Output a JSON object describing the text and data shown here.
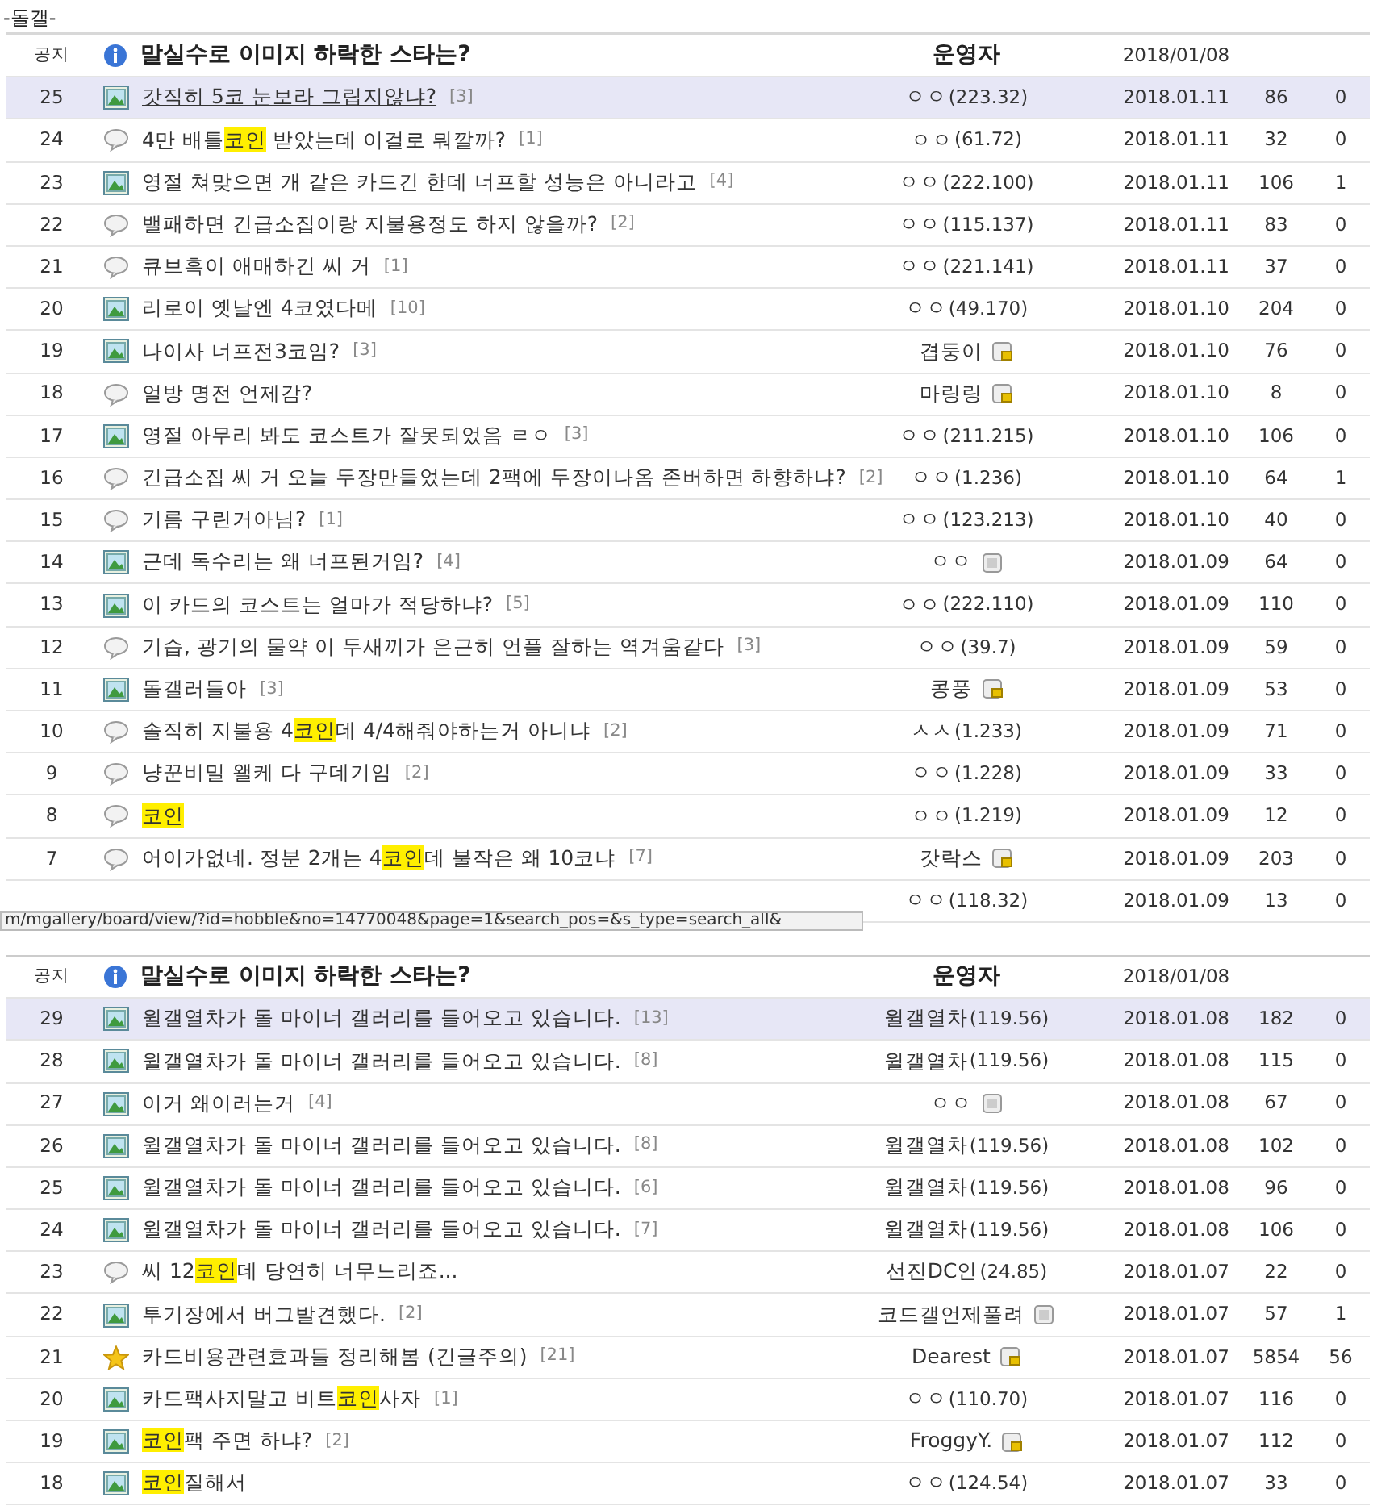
{
  "board_title": "-돌갤-",
  "sections": [
    {
      "notice": {
        "label": "공지",
        "title": "말실수로 이미지 하락한 스타는?",
        "author": "운영자",
        "date": "2018/01/08"
      },
      "posts": [
        {
          "number": "25",
          "kind": "image",
          "title": [
            {
              "text": "갓직히 5코 눈보라 그립지않냐?",
              "highlight": false
            }
          ],
          "comments": "[3]",
          "author": "ㅇㅇ",
          "ip": "(223.32)",
          "date": "2018.01.11",
          "views": "86",
          "recommends": "0",
          "highlighted": true,
          "underlined": true
        },
        {
          "number": "24",
          "kind": "comment",
          "title": [
            {
              "text": "4만 배틀",
              "highlight": false
            },
            {
              "text": "코인",
              "highlight": true
            },
            {
              "text": " 받았는데 이걸로 뭐깔까?",
              "highlight": false
            }
          ],
          "comments": "[1]",
          "author": "ㅇㅇ",
          "ip": "(61.72)",
          "date": "2018.01.11",
          "views": "32",
          "recommends": "0",
          "highlighted": false,
          "underlined": false
        },
        {
          "number": "23",
          "kind": "image",
          "title": [
            {
              "text": "영절 쳐맞으면 개 같은 카드긴 한데 너프할 성능은 아니라고",
              "highlight": false
            }
          ],
          "comments": "[4]",
          "author": "ㅇㅇ",
          "ip": "(222.100)",
          "date": "2018.01.11",
          "views": "106",
          "recommends": "1",
          "highlighted": false,
          "underlined": false
        },
        {
          "number": "22",
          "kind": "comment",
          "title": [
            {
              "text": "밸패하면 긴급소집이랑 지불용정도 하지 않을까?",
              "highlight": false
            }
          ],
          "comments": "[2]",
          "author": "ㅇㅇ",
          "ip": "(115.137)",
          "date": "2018.01.11",
          "views": "83",
          "recommends": "0",
          "highlighted": false,
          "underlined": false
        },
        {
          "number": "21",
          "kind": "comment",
          "title": [
            {
              "text": "큐브흑이 애매하긴 씨 거",
              "highlight": false
            }
          ],
          "comments": "[1]",
          "author": "ㅇㅇ",
          "ip": "(221.141)",
          "date": "2018.01.11",
          "views": "37",
          "recommends": "0",
          "highlighted": false,
          "underlined": false
        },
        {
          "number": "20",
          "kind": "image",
          "title": [
            {
              "text": "리로이 옛날엔 4코였다메",
              "highlight": false
            }
          ],
          "comments": "[10]",
          "author": "ㅇㅇ",
          "ip": "(49.170)",
          "date": "2018.01.10",
          "views": "204",
          "recommends": "0",
          "highlighted": false,
          "underlined": false
        },
        {
          "number": "19",
          "kind": "image",
          "title": [
            {
              "text": "나이사 너프전3코임?",
              "highlight": false
            }
          ],
          "comments": "[3]",
          "author": "겹둥이",
          "author_icon": {
            "kind": "fixed"
          },
          "date": "2018.01.10",
          "views": "76",
          "recommends": "0",
          "highlighted": false,
          "underlined": false
        },
        {
          "number": "18",
          "kind": "comment",
          "title": [
            {
              "text": "얼방 명전 언제감?",
              "highlight": false
            }
          ],
          "author": "마링링",
          "author_icon": {
            "kind": "fixed"
          },
          "date": "2018.01.10",
          "views": "8",
          "recommends": "0",
          "highlighted": false,
          "underlined": false
        },
        {
          "number": "17",
          "kind": "image",
          "title": [
            {
              "text": "영절 아무리 봐도 코스트가 잘못되었음 ㄹㅇ",
              "highlight": false
            }
          ],
          "comments": "[3]",
          "author": "ㅇㅇ",
          "ip": "(211.215)",
          "date": "2018.01.10",
          "views": "106",
          "recommends": "0",
          "highlighted": false,
          "underlined": false
        },
        {
          "number": "16",
          "kind": "comment",
          "title": [
            {
              "text": "긴급소집 씨 거 오늘 두장만들었는데 2팩에 두장이나옴 존버하면 하향하냐?",
              "highlight": false
            }
          ],
          "comments": "[2]",
          "author": "ㅇㅇ",
          "ip": "(1.236)",
          "date": "2018.01.10",
          "views": "64",
          "recommends": "1",
          "highlighted": false,
          "underlined": false
        },
        {
          "number": "15",
          "kind": "comment",
          "title": [
            {
              "text": "기름 구린거아님?",
              "highlight": false
            }
          ],
          "comments": "[1]",
          "author": "ㅇㅇ",
          "ip": "(123.213)",
          "date": "2018.01.10",
          "views": "40",
          "recommends": "0",
          "highlighted": false,
          "underlined": false
        },
        {
          "number": "14",
          "kind": "image",
          "title": [
            {
              "text": "근데 독수리는 왜 너프된거임?",
              "highlight": false
            }
          ],
          "comments": "[4]",
          "author": "ㅇㅇ",
          "author_icon": {
            "kind": "plain"
          },
          "date": "2018.01.09",
          "views": "64",
          "recommends": "0",
          "highlighted": false,
          "underlined": false
        },
        {
          "number": "13",
          "kind": "image",
          "title": [
            {
              "text": "이 카드의 코스트는 얼마가 적당하냐?",
              "highlight": false
            }
          ],
          "comments": "[5]",
          "author": "ㅇㅇ",
          "ip": "(222.110)",
          "date": "2018.01.09",
          "views": "110",
          "recommends": "0",
          "highlighted": false,
          "underlined": false
        },
        {
          "number": "12",
          "kind": "comment",
          "title": [
            {
              "text": "기습, 광기의 물약 이 두새끼가 은근히 언플 잘하는 역겨움같다",
              "highlight": false
            }
          ],
          "comments": "[3]",
          "author": "ㅇㅇ",
          "ip": "(39.7)",
          "date": "2018.01.09",
          "views": "59",
          "recommends": "0",
          "highlighted": false,
          "underlined": false
        },
        {
          "number": "11",
          "kind": "image",
          "title": [
            {
              "text": "돌갤러들아",
              "highlight": false
            }
          ],
          "comments": "[3]",
          "author": "콩풍",
          "author_icon": {
            "kind": "fixed"
          },
          "date": "2018.01.09",
          "views": "53",
          "recommends": "0",
          "highlighted": false,
          "underlined": false
        },
        {
          "number": "10",
          "kind": "comment",
          "title": [
            {
              "text": "솔직히 지불용 4",
              "highlight": false
            },
            {
              "text": "코인",
              "highlight": true
            },
            {
              "text": "데 4/4해줘야하는거 아니냐",
              "highlight": false
            }
          ],
          "comments": "[2]",
          "author": "ㅅㅅ",
          "ip": "(1.233)",
          "date": "2018.01.09",
          "views": "71",
          "recommends": "0",
          "highlighted": false,
          "underlined": false
        },
        {
          "number": "9",
          "kind": "comment",
          "title": [
            {
              "text": "냥꾼비밀 왤케 다 구데기임",
              "highlight": false
            }
          ],
          "comments": "[2]",
          "author": "ㅇㅇ",
          "ip": "(1.228)",
          "date": "2018.01.09",
          "views": "33",
          "recommends": "0",
          "highlighted": false,
          "underlined": false
        },
        {
          "number": "8",
          "kind": "comment",
          "title": [
            {
              "text": "코인",
              "highlight": true
            }
          ],
          "author": "ㅇㅇ",
          "ip": "(1.219)",
          "date": "2018.01.09",
          "views": "12",
          "recommends": "0",
          "highlighted": false,
          "underlined": false
        },
        {
          "number": "7",
          "kind": "comment",
          "title": [
            {
              "text": "어이가없네. 정분 2개는 4",
              "highlight": false
            },
            {
              "text": "코인",
              "highlight": true
            },
            {
              "text": "데 불작은 왜 10코냐",
              "highlight": false
            }
          ],
          "comments": "[7]",
          "author": "갓락스",
          "author_icon": {
            "kind": "fixed"
          },
          "date": "2018.01.09",
          "views": "203",
          "recommends": "0",
          "highlighted": false,
          "underlined": false
        },
        {
          "author": "ㅇㅇ",
          "ip": "(118.32)",
          "date": "2018.01.09",
          "views": "13",
          "recommends": "0",
          "highlighted": false
        }
      ],
      "status_url": "m/mgallery/board/view/?id=hobble&no=14770048&page=1&search_pos=&s_type=search_all&"
    },
    {
      "notice": {
        "label": "공지",
        "title": "말실수로 이미지 하락한 스타는?",
        "author": "운영자",
        "date": "2018/01/08"
      },
      "posts": [
        {
          "number": "29",
          "kind": "image",
          "title": [
            {
              "text": "윌갤열차가 돌 마이너 갤러리를 들어오고 있습니다.",
              "highlight": false
            }
          ],
          "comments": "[13]",
          "author": "윌갤열차",
          "ip": "(119.56)",
          "date": "2018.01.08",
          "views": "182",
          "recommends": "0",
          "highlighted": true,
          "underlined": false
        },
        {
          "number": "28",
          "kind": "image",
          "title": [
            {
              "text": "윌갤열차가 돌 마이너 갤러리를 들어오고 있습니다.",
              "highlight": false
            }
          ],
          "comments": "[8]",
          "author": "윌갤열차",
          "ip": "(119.56)",
          "date": "2018.01.08",
          "views": "115",
          "recommends": "0",
          "highlighted": false,
          "underlined": false
        },
        {
          "number": "27",
          "kind": "image",
          "title": [
            {
              "text": "이거 왜이러는거",
              "highlight": false
            }
          ],
          "comments": "[4]",
          "author": "ㅇㅇ",
          "author_icon": {
            "kind": "plain"
          },
          "date": "2018.01.08",
          "views": "67",
          "recommends": "0",
          "highlighted": false,
          "underlined": false
        },
        {
          "number": "26",
          "kind": "image",
          "title": [
            {
              "text": "윌갤열차가 돌 마이너 갤러리를 들어오고 있습니다.",
              "highlight": false
            }
          ],
          "comments": "[8]",
          "author": "윌갤열차",
          "ip": "(119.56)",
          "date": "2018.01.08",
          "views": "102",
          "recommends": "0",
          "highlighted": false,
          "underlined": false
        },
        {
          "number": "25",
          "kind": "image",
          "title": [
            {
              "text": "윌갤열차가 돌 마이너 갤러리를 들어오고 있습니다.",
              "highlight": false
            }
          ],
          "comments": "[6]",
          "author": "윌갤열차",
          "ip": "(119.56)",
          "date": "2018.01.08",
          "views": "96",
          "recommends": "0",
          "highlighted": false,
          "underlined": false
        },
        {
          "number": "24",
          "kind": "image",
          "title": [
            {
              "text": "윌갤열차가 돌 마이너 갤러리를 들어오고 있습니다.",
              "highlight": false
            }
          ],
          "comments": "[7]",
          "author": "윌갤열차",
          "ip": "(119.56)",
          "date": "2018.01.08",
          "views": "106",
          "recommends": "0",
          "highlighted": false,
          "underlined": false
        },
        {
          "number": "23",
          "kind": "comment",
          "title": [
            {
              "text": "씨 12",
              "highlight": false
            },
            {
              "text": "코인",
              "highlight": true
            },
            {
              "text": "데 당연히 너무느리죠...",
              "highlight": false
            }
          ],
          "author": "선진DC인",
          "ip": "(24.85)",
          "date": "2018.01.07",
          "views": "22",
          "recommends": "0",
          "highlighted": false,
          "underlined": false
        },
        {
          "number": "22",
          "kind": "image",
          "title": [
            {
              "text": "투기장에서 버그발견했다.",
              "highlight": false
            }
          ],
          "comments": "[2]",
          "author": "코드갤언제풀려",
          "author_icon": {
            "kind": "plain"
          },
          "date": "2018.01.07",
          "views": "57",
          "recommends": "1",
          "highlighted": false,
          "underlined": false
        },
        {
          "number": "21",
          "kind": "star",
          "title": [
            {
              "text": "카드비용관련효과들 정리해봄 (긴글주의)",
              "highlight": false
            }
          ],
          "comments": "[21]",
          "author": "Dearest",
          "author_icon": {
            "kind": "fixed"
          },
          "date": "2018.01.07",
          "views": "5854",
          "recommends": "56",
          "highlighted": false,
          "underlined": false
        },
        {
          "number": "20",
          "kind": "image",
          "title": [
            {
              "text": "카드팩사지말고 비트",
              "highlight": false
            },
            {
              "text": "코인",
              "highlight": true
            },
            {
              "text": "사자",
              "highlight": false
            }
          ],
          "comments": "[1]",
          "author": "ㅇㅇ",
          "ip": "(110.70)",
          "date": "2018.01.07",
          "views": "116",
          "recommends": "0",
          "highlighted": false,
          "underlined": false
        },
        {
          "number": "19",
          "kind": "image",
          "title": [
            {
              "text": "코인",
              "highlight": true
            },
            {
              "text": "팩 주면 하냐?",
              "highlight": false
            }
          ],
          "comments": "[2]",
          "author": "FroggyY.",
          "author_icon": {
            "kind": "fixed"
          },
          "date": "2018.01.07",
          "views": "112",
          "recommends": "0",
          "highlighted": false,
          "underlined": false
        },
        {
          "number": "18",
          "kind": "image",
          "title": [
            {
              "text": "코인",
              "highlight": true
            },
            {
              "text": "질해서",
              "highlight": false
            }
          ],
          "author": "ㅇㅇ",
          "ip": "(124.54)",
          "date": "2018.01.07",
          "views": "33",
          "recommends": "0",
          "highlighted": false,
          "underlined": false
        }
      ]
    }
  ]
}
